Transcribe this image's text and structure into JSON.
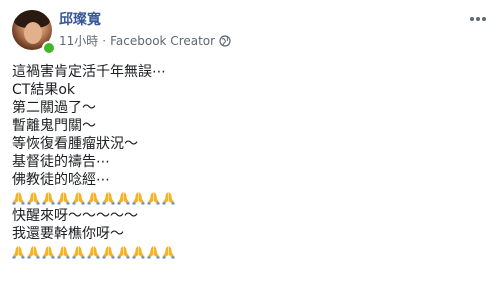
{
  "post": {
    "author": "邱璨寬",
    "time": "11小時",
    "separator": "·",
    "role": "Facebook Creator",
    "privacy_icon": "globe-icon",
    "more_icon": "more-horizontal-icon",
    "lines": [
      "這禍害肯定活千年無誤⋯",
      "CT結果ok",
      "第二關過了～",
      "暫離鬼門關～",
      "等恢復看腫瘤狀況～",
      "基督徒的禱告⋯",
      "佛教徒的唸經⋯",
      "🙏🙏🙏🙏🙏🙏🙏🙏🙏🙏🙏",
      "快醒來呀～～～～～",
      "我還要幹樵你呀～",
      "🙏🙏🙏🙏🙏🙏🙏🙏🙏🙏🙏"
    ],
    "colors": {
      "author": "#385898",
      "meta": "#606770",
      "online": "#42b72a",
      "emoji": "#f7b125"
    }
  }
}
